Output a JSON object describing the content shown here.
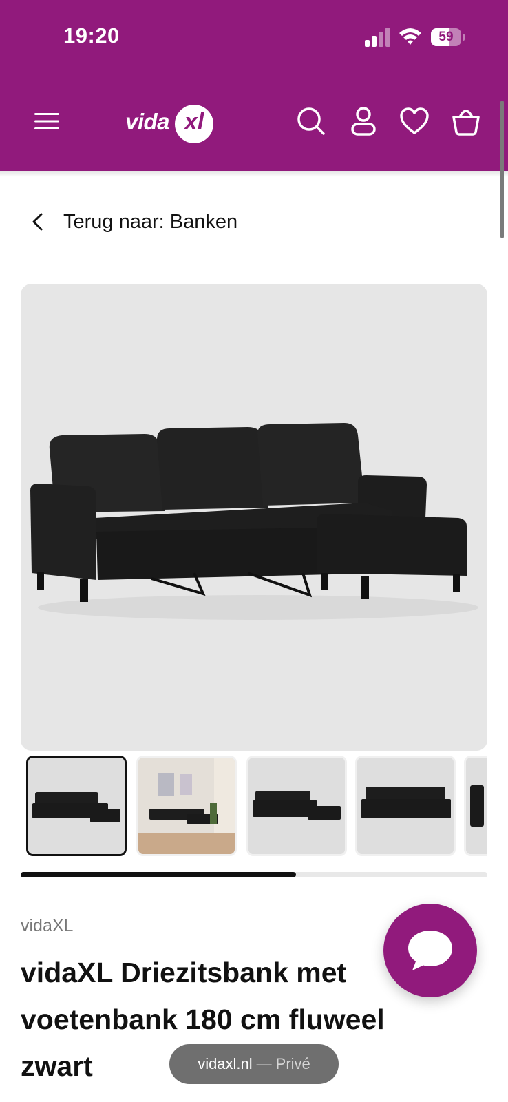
{
  "status_bar": {
    "time": "19:20",
    "battery": "59",
    "battery_level_percent": 59,
    "signal_bars_active": 2,
    "signal_bars_total": 4
  },
  "header": {
    "logo_text": "vida",
    "logo_mark": "xl",
    "icons": [
      "menu-icon",
      "search-icon",
      "account-icon",
      "wishlist-heart-icon",
      "cart-basket-icon"
    ],
    "brand_color": "#911a7c"
  },
  "breadcrumb": {
    "back_label": "Terug naar: Banken"
  },
  "gallery": {
    "thumbnails": [
      "thumb-1",
      "thumb-2",
      "thumb-3",
      "thumb-4",
      "thumb-5"
    ],
    "active_index": 0,
    "scroll_progress_fraction": 0.59
  },
  "product": {
    "brand": "vidaXL",
    "title": "vidaXL Driezitsbank met voetenbank 180 cm fluweel zwart"
  },
  "chat": {
    "icon": "chat-bubble-icon"
  },
  "browser": {
    "domain": "vidaxl.nl",
    "separator": "—",
    "mode": "Privé"
  }
}
